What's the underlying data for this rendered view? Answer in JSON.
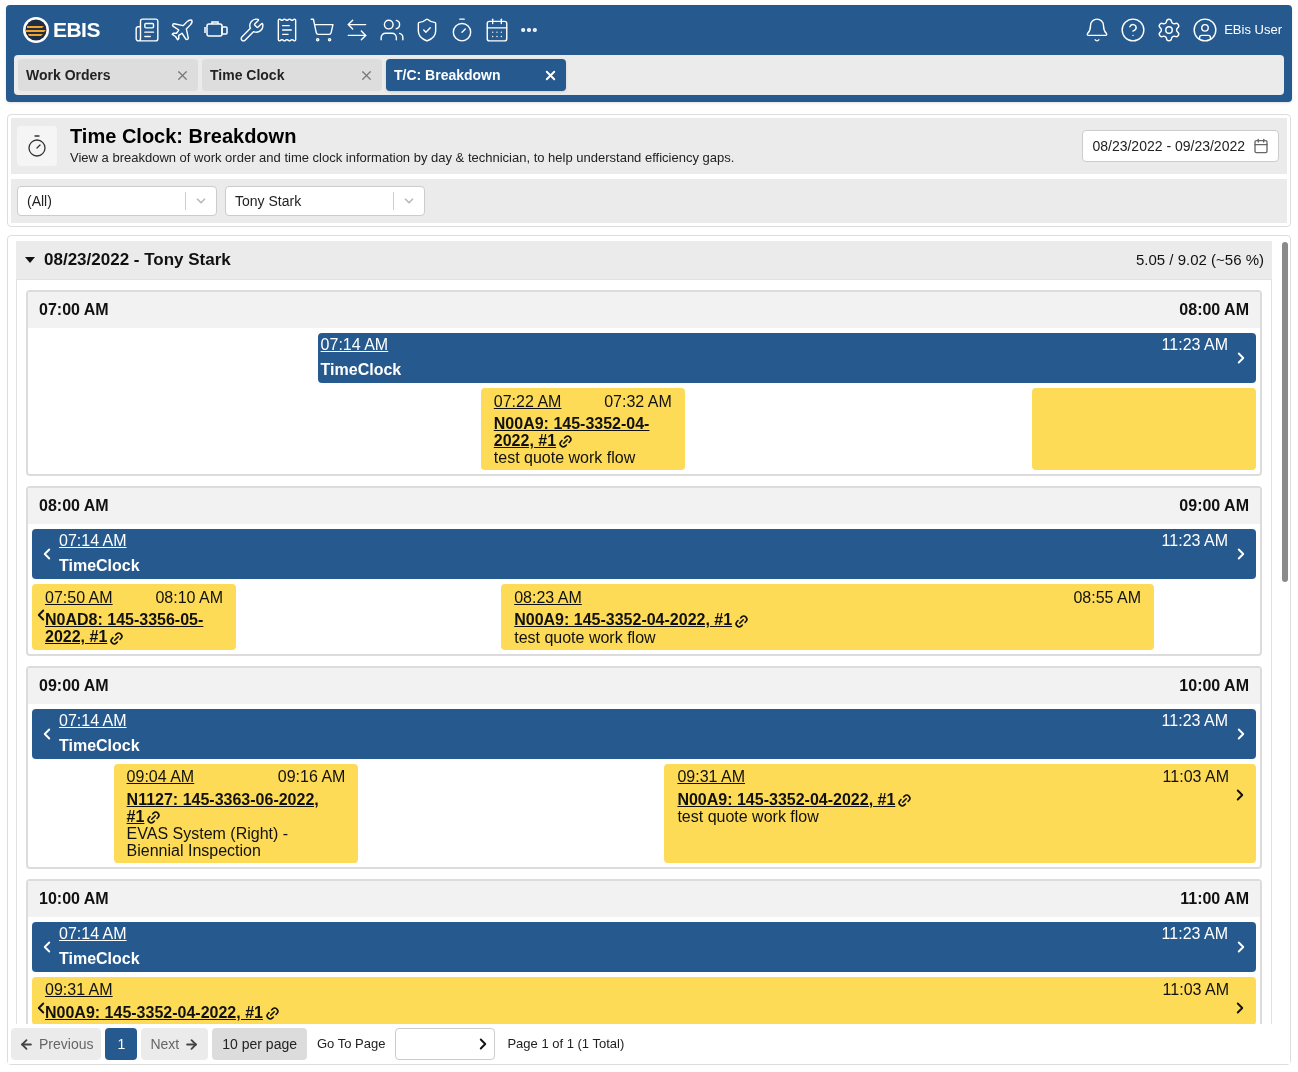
{
  "app": {
    "logo": "EBIS",
    "user": "EBis User"
  },
  "tabs": [
    {
      "label": "Work Orders",
      "selected": false
    },
    {
      "label": "Time Clock",
      "selected": false
    },
    {
      "label": "T/C: Breakdown",
      "selected": true
    }
  ],
  "page": {
    "title": "Time Clock: Breakdown",
    "description": "View a breakdown of work order and time clock information by day & technician, to help understand efficiency gaps.",
    "date_range": "08/23/2022 - 09/23/2022"
  },
  "filters": [
    {
      "value": "(All)"
    },
    {
      "value": "Tony Stark"
    }
  ],
  "day": {
    "title": "08/23/2022 - Tony Stark",
    "expanded": true,
    "summary": "5.05 / 9.02 (~56 %)",
    "hours": [
      {
        "start": "07:00 AM",
        "end": "08:00 AM",
        "timeclock": {
          "start": "07:14 AM",
          "end": "11:23 AM",
          "label": "TimeClock"
        },
        "entries": [
          {
            "kind": "work_order",
            "start": "07:22 AM",
            "end": "07:32 AM",
            "order": "N00A9: 145-3352-04-2022, #1",
            "description": "test quote work flow"
          },
          {
            "kind": "continued"
          }
        ]
      },
      {
        "start": "08:00 AM",
        "end": "09:00 AM",
        "timeclock": {
          "start": "07:14 AM",
          "end": "11:23 AM",
          "label": "TimeClock"
        },
        "entries": [
          {
            "kind": "work_order",
            "start": "07:50 AM",
            "end": "08:10 AM",
            "order": "N0AD8: 145-3356-05-2022, #1"
          },
          {
            "kind": "work_order",
            "start": "08:23 AM",
            "end": "08:55 AM",
            "order": "N00A9: 145-3352-04-2022, #1",
            "description": "test quote work flow"
          }
        ]
      },
      {
        "start": "09:00 AM",
        "end": "10:00 AM",
        "timeclock": {
          "start": "07:14 AM",
          "end": "11:23 AM",
          "label": "TimeClock"
        },
        "entries": [
          {
            "kind": "work_order",
            "start": "09:04 AM",
            "end": "09:16 AM",
            "order": "N1127: 145-3363-06-2022, #1",
            "description": "EVAS System (Right) - Biennial Inspection"
          },
          {
            "kind": "work_order",
            "start": "09:31 AM",
            "end": "11:03 AM",
            "order": "N00A9: 145-3352-04-2022, #1",
            "description": "test quote work flow"
          }
        ]
      },
      {
        "start": "10:00 AM",
        "end": "11:00 AM",
        "timeclock": {
          "start": "07:14 AM",
          "end": "11:23 AM",
          "label": "TimeClock"
        },
        "entries": [
          {
            "kind": "work_order",
            "start": "09:31 AM",
            "end": "11:03 AM",
            "order": "N00A9: 145-3352-04-2022, #1"
          }
        ]
      }
    ]
  },
  "pagination": {
    "previous": "Previous",
    "pages": [
      {
        "label": "1",
        "selected": true
      }
    ],
    "next": "Next",
    "per_page": "10 per page",
    "go_to_label": "Go To Page",
    "summary": "Page 1 of 1 (1 Total)"
  }
}
